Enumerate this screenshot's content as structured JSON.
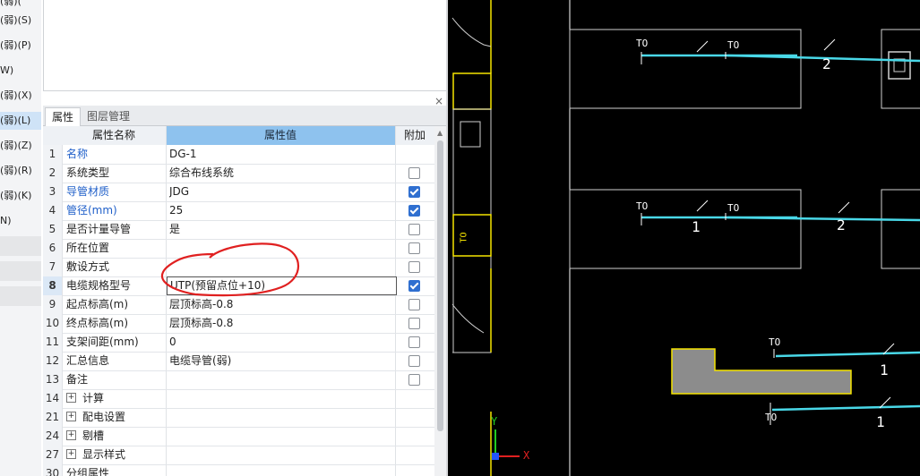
{
  "left_strip": {
    "items": [
      "(弱)(S)",
      "(弱)(P)",
      "W)",
      "(弱)(X)",
      "(弱)(L)",
      "(弱)(Z)",
      "(弱)(R)",
      "(弱)(K)",
      "N)"
    ],
    "selected_index": 4
  },
  "tabs": [
    "属性",
    "图层管理"
  ],
  "close_glyph": "×",
  "table": {
    "headers": [
      "属性名称",
      "属性值",
      "附加"
    ],
    "rows": [
      {
        "num": "1",
        "name": "名称",
        "value": "DG-1",
        "blue": true,
        "checkbox": null
      },
      {
        "num": "2",
        "name": "系统类型",
        "value": "综合布线系统",
        "blue": false,
        "checkbox": false
      },
      {
        "num": "3",
        "name": "导管材质",
        "value": "JDG",
        "blue": true,
        "checkbox": true
      },
      {
        "num": "4",
        "name": "管径(mm)",
        "value": "25",
        "blue": true,
        "checkbox": true
      },
      {
        "num": "5",
        "name": "是否计量导管",
        "value": "是",
        "blue": false,
        "checkbox": false
      },
      {
        "num": "6",
        "name": "所在位置",
        "value": "",
        "blue": false,
        "checkbox": false
      },
      {
        "num": "7",
        "name": "敷设方式",
        "value": "",
        "blue": false,
        "checkbox": false
      },
      {
        "num": "8",
        "name": "电缆规格型号",
        "value": "UTP(预留点位+10)",
        "blue": false,
        "checkbox": true,
        "selected": true
      },
      {
        "num": "9",
        "name": "起点标高(m)",
        "value": "层顶标高-0.8",
        "blue": false,
        "checkbox": false
      },
      {
        "num": "10",
        "name": "终点标高(m)",
        "value": "层顶标高-0.8",
        "blue": false,
        "checkbox": false
      },
      {
        "num": "11",
        "name": "支架间距(mm)",
        "value": "0",
        "blue": false,
        "checkbox": false
      },
      {
        "num": "12",
        "name": "汇总信息",
        "value": "电缆导管(弱)",
        "blue": false,
        "checkbox": false
      },
      {
        "num": "13",
        "name": "备注",
        "value": "",
        "blue": false,
        "checkbox": false
      },
      {
        "num": "14",
        "name": "计算",
        "value": "",
        "group": true
      },
      {
        "num": "21",
        "name": "配电设置",
        "value": "",
        "group": true
      },
      {
        "num": "24",
        "name": "剔槽",
        "value": "",
        "group": true
      },
      {
        "num": "27",
        "name": "显示样式",
        "value": "",
        "group": true
      },
      {
        "num": "30",
        "name": "分组属性",
        "value": "",
        "group": false
      }
    ]
  },
  "cad": {
    "labels": [
      "TO",
      "TO",
      "2",
      "TO",
      "TO",
      "1",
      "2",
      "TO",
      "1",
      "TO",
      "1",
      "TO"
    ],
    "axis_y": "Y",
    "axis_x": "X",
    "colors": {
      "background": "#000000",
      "pipe": "#49d8e8",
      "wall": "#ffffff",
      "yellow": "#f5e400",
      "annotation": "#ff2020",
      "axis_x": "#e02020",
      "axis_y": "#22cc22"
    }
  }
}
